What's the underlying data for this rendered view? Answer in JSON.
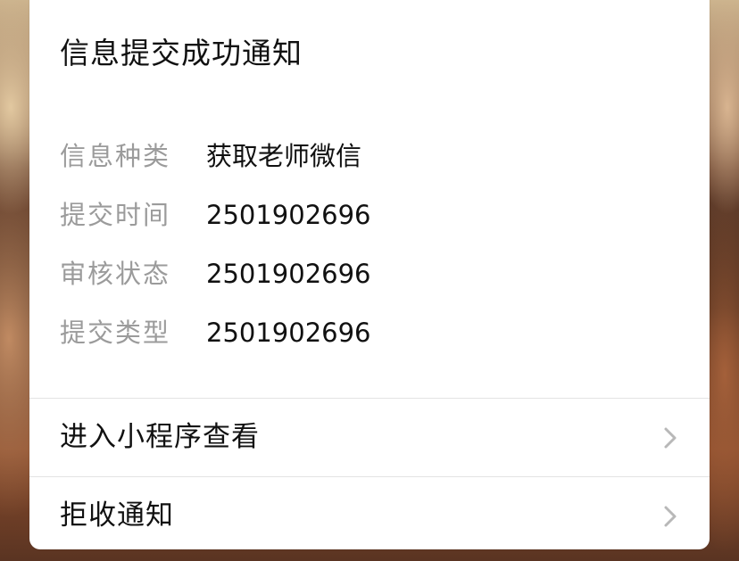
{
  "card": {
    "title": "信息提交成功通知"
  },
  "fields": [
    {
      "label": "信息种类",
      "value": "获取老师微信"
    },
    {
      "label": "提交时间",
      "value": "2501902696"
    },
    {
      "label": "审核状态",
      "value": "2501902696"
    },
    {
      "label": "提交类型",
      "value": "2501902696"
    }
  ],
  "actions": {
    "open_miniprogram": "进入小程序查看",
    "reject_notice": "拒收通知"
  },
  "icons": {
    "chevron": "chevron-right-icon"
  },
  "colors": {
    "card_bg": "#ffffff",
    "label_gray": "#9b9b9b",
    "text_dark": "#111111",
    "divider": "#e3e3e3",
    "chevron": "#b8b8b8"
  }
}
